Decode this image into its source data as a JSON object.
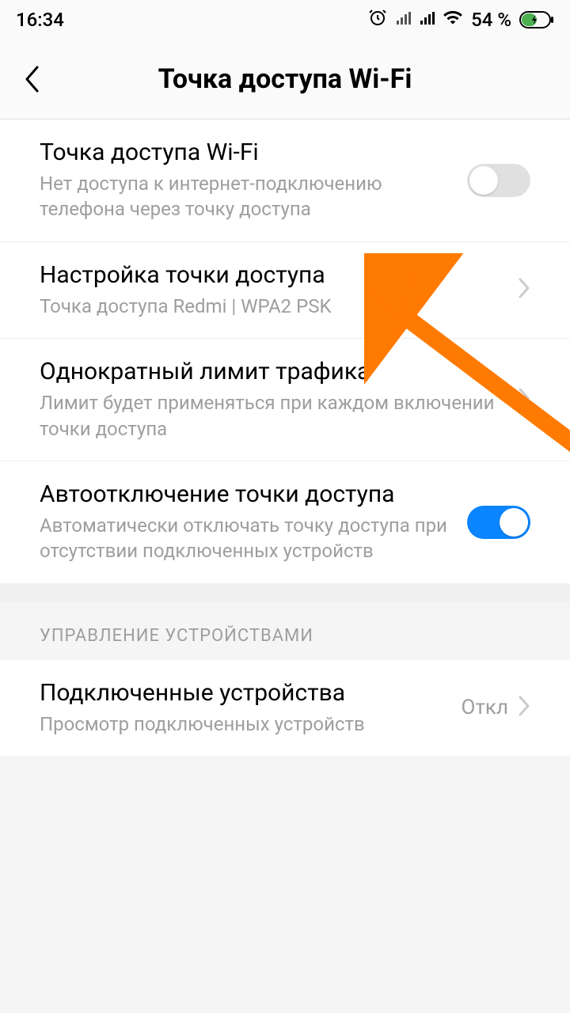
{
  "status": {
    "time": "16:34",
    "battery_percent": "54 %"
  },
  "header": {
    "title": "Точка доступа Wi-Fi"
  },
  "settings": {
    "hotspot": {
      "title": "Точка доступа Wi-Fi",
      "subtitle": "Нет доступа к интернет-подключению телефона через точку доступа"
    },
    "hotspot_setup": {
      "title": "Настройка точки доступа",
      "subtitle": "Точка доступа Redmi | WPA2 PSK"
    },
    "traffic_limit": {
      "title": "Однократный лимит трафика",
      "subtitle": "Лимит будет применяться при каждом включении точки доступа"
    },
    "auto_disable": {
      "title": "Автоотключение точки доступа",
      "subtitle": "Автоматически отключать точку доступа при отсутствии подключенных устройств"
    }
  },
  "section_header": {
    "devices": "УПРАВЛЕНИЕ УСТРОЙСТВАМИ"
  },
  "devices": {
    "connected": {
      "title": "Подключенные устройства",
      "subtitle": "Просмотр подключенных устройств",
      "value": "Откл"
    }
  }
}
